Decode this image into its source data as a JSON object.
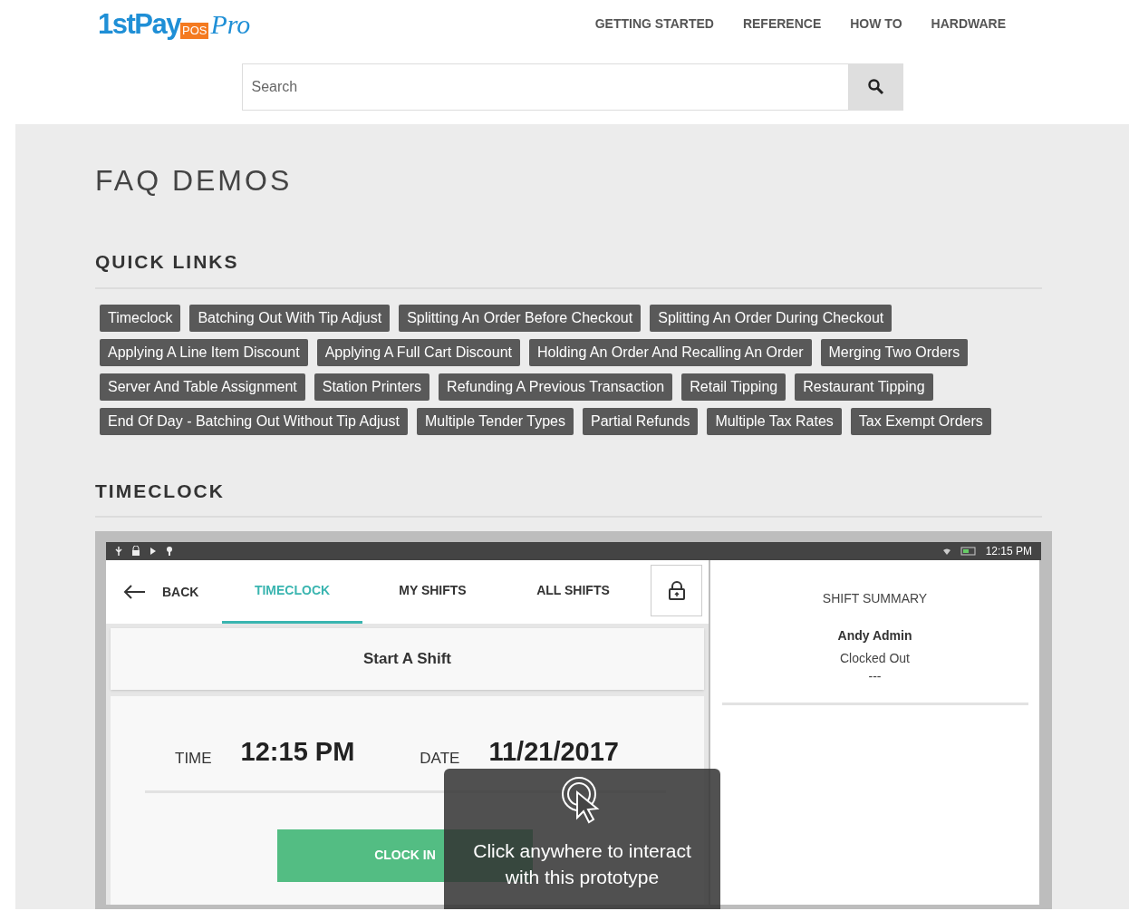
{
  "logo": {
    "main": "1stPay",
    "badge": "POS",
    "script": "Pro"
  },
  "nav": [
    "GETTING STARTED",
    "REFERENCE",
    "HOW TO",
    "HARDWARE"
  ],
  "search": {
    "placeholder": "Search"
  },
  "page_title": "FAQ DEMOS",
  "quick_links": {
    "heading": "QUICK LINKS",
    "links": [
      "Timeclock",
      "Batching Out With Tip Adjust",
      "Splitting An Order Before Checkout",
      "Splitting An Order During Checkout",
      "Applying A Line Item Discount",
      "Applying A Full Cart Discount",
      "Holding An Order And Recalling An Order",
      "Merging Two Orders",
      "Server And Table Assignment",
      "Station Printers",
      "Refunding A Previous Transaction",
      "Retail Tipping",
      "Restaurant Tipping",
      "End Of Day - Batching Out Without Tip Adjust",
      "Multiple Tender Types",
      "Partial Refunds",
      "Multiple Tax Rates",
      "Tax Exempt Orders"
    ]
  },
  "section": {
    "heading": "TIMECLOCK"
  },
  "prototype": {
    "status_time": "12:15 PM",
    "back": "BACK",
    "tabs": [
      {
        "label": "TIMECLOCK",
        "selected": true
      },
      {
        "label": "MY SHIFTS",
        "selected": false
      },
      {
        "label": "ALL SHIFTS",
        "selected": false
      }
    ],
    "start_title": "Start A Shift",
    "time_label": "TIME",
    "time_value": "12:15 PM",
    "date_label": "DATE",
    "date_value": "11/21/2017",
    "clock_in": "CLOCK IN",
    "summary": {
      "title": "SHIFT SUMMARY",
      "name": "Andy Admin",
      "status": "Clocked Out",
      "detail": "---"
    },
    "overlay": {
      "line1": "Click anywhere to interact",
      "line2": "with this prototype"
    }
  }
}
